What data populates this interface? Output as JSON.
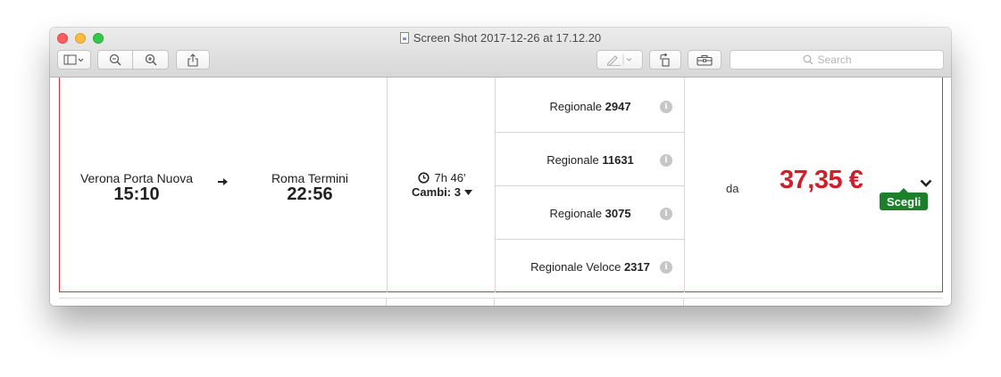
{
  "window": {
    "title": "Screen Shot 2017-12-26 at 17.12.20"
  },
  "toolbar": {
    "search_placeholder": "Search"
  },
  "journey": {
    "departure_station": "Verona Porta Nuova",
    "departure_time": "15:10",
    "arrival_station": "Roma Termini",
    "arrival_time": "22:56",
    "duration": "7h 46'",
    "changes": "Cambi: 3",
    "trains": [
      {
        "type": "Regionale",
        "number": "2947"
      },
      {
        "type": "Regionale",
        "number": "11631"
      },
      {
        "type": "Regionale",
        "number": "3075"
      },
      {
        "type": "Regionale Veloce",
        "number": "2317"
      }
    ],
    "price_prefix": "da",
    "price": "37,35 €",
    "choose_label": "Scegli"
  },
  "colors": {
    "price": "#d01f2c",
    "choose_button": "#1c7f2a",
    "card_border": "#d9303f"
  }
}
